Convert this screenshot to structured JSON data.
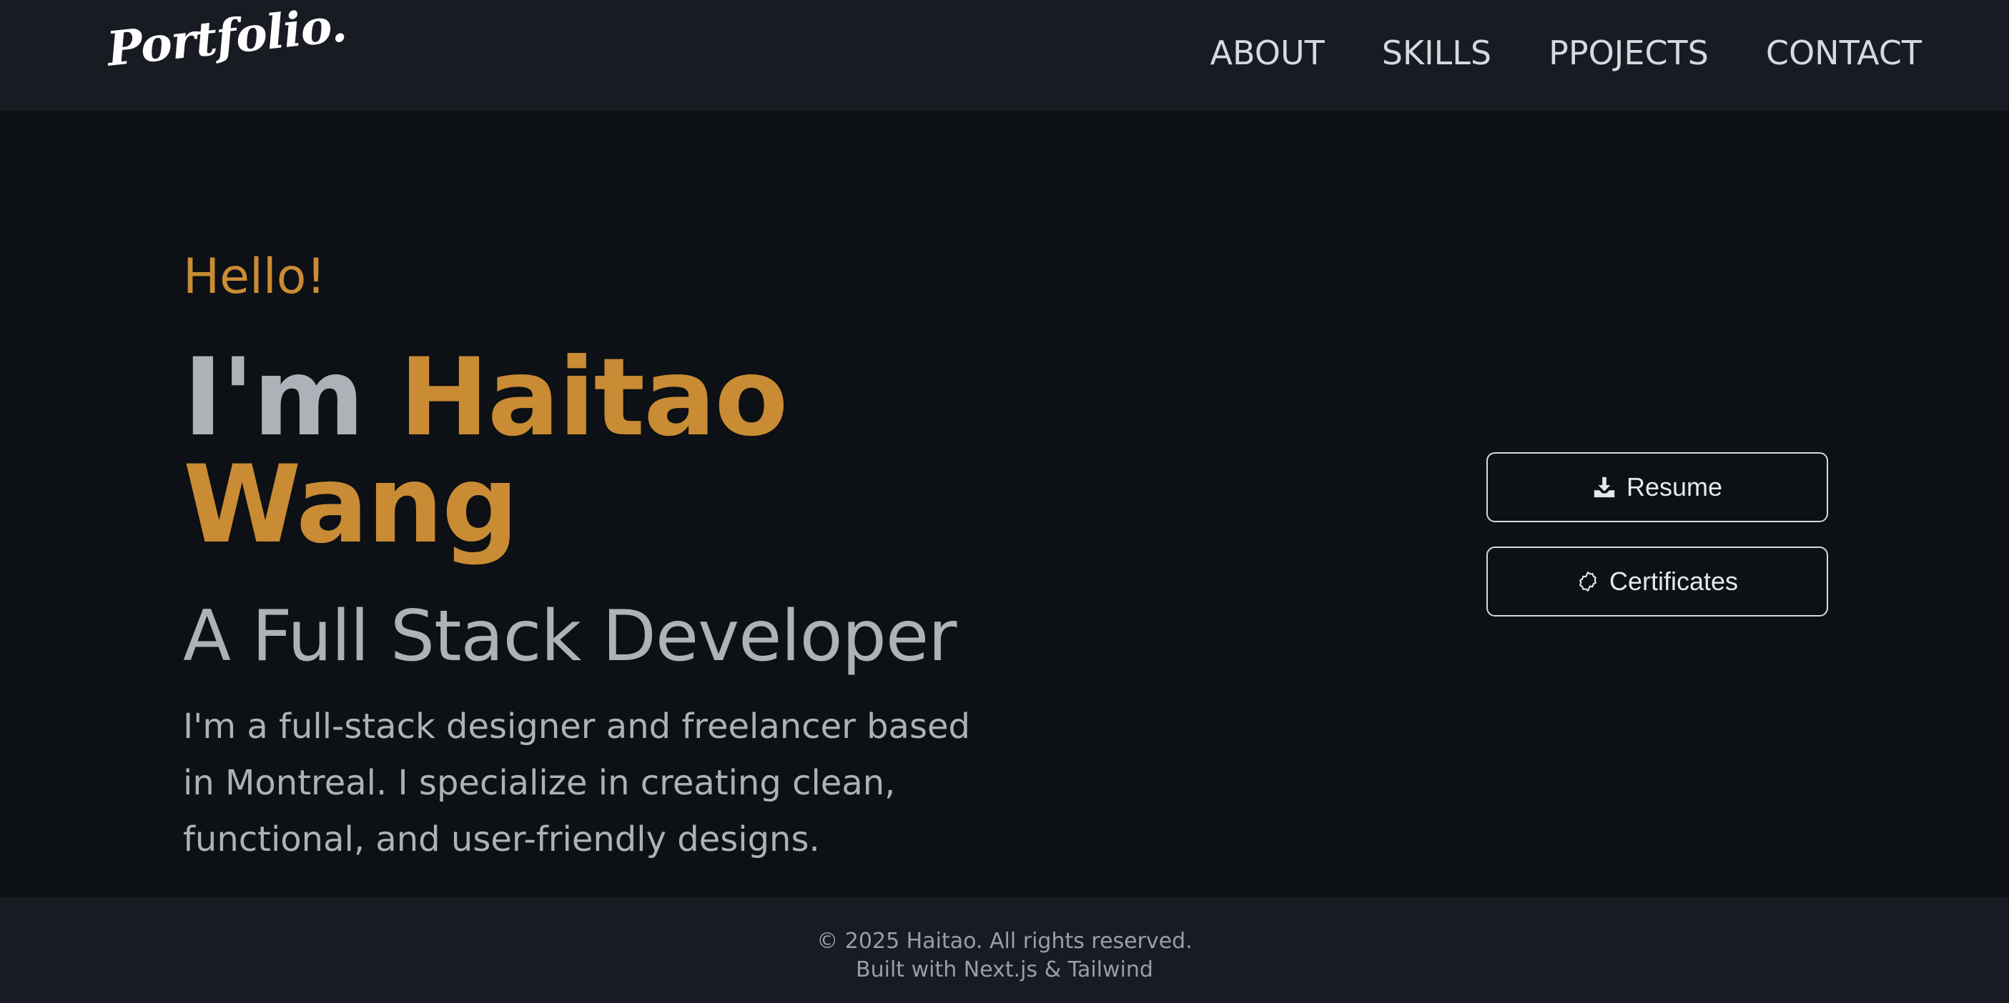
{
  "header": {
    "logo_text": "Portfolio.",
    "nav": [
      "ABOUT",
      "SKILLS",
      "PPOJECTS",
      "CONTACT"
    ]
  },
  "hero": {
    "greeting": "Hello!",
    "name_prefix": "I'm",
    "name": "Haitao Wang",
    "role": "A Full Stack Developer",
    "description": "I'm a full-stack designer and freelancer based in Montreal. I specialize in creating clean, functional, and user-friendly designs."
  },
  "actions": {
    "resume_label": "Resume",
    "resume_icon": "download-icon",
    "certificates_label": "Certificates",
    "certificates_icon": "badge-icon"
  },
  "footer": {
    "copyright": "© 2025 Haitao. All rights reserved.",
    "built_with": "Built with Next.js & Tailwind"
  },
  "colors": {
    "background": "#0d1014",
    "header_bg": "#181b22",
    "accent": "#c98b34",
    "text_muted": "#aeb1b8",
    "nav_text": "#d6d9df"
  }
}
